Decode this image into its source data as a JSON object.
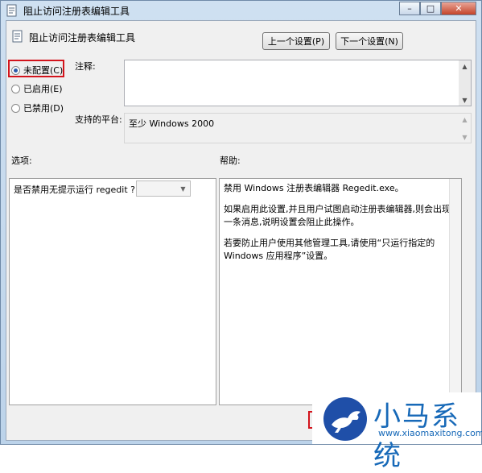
{
  "window": {
    "title": "阻止访问注册表编辑工具",
    "controls": {
      "minimize": "–",
      "maximize": "□",
      "close": "✕"
    }
  },
  "header": {
    "policy_name": "阻止访问注册表编辑工具",
    "prev_button": "上一个设置(P)",
    "next_button": "下一个设置(N)"
  },
  "state": {
    "options": [
      {
        "label": "未配置(C)",
        "selected": true
      },
      {
        "label": "已启用(E)",
        "selected": false
      },
      {
        "label": "已禁用(D)",
        "selected": false
      }
    ]
  },
  "comment": {
    "label": "注释:",
    "value": ""
  },
  "platform": {
    "label": "支持的平台:",
    "value": "至少 Windows 2000"
  },
  "options_section": {
    "label": "选项:",
    "question": "是否禁用无提示运行 regedit ?",
    "select_value": ""
  },
  "help_section": {
    "label": "帮助:",
    "paragraphs": [
      "禁用 Windows 注册表编辑器 Regedit.exe。",
      "如果启用此设置,并且用户试图启动注册表编辑器,则会出现一条消息,说明设置会阻止此操作。",
      "若要防止用户使用其他管理工具,请使用“只运行指定的 Windows 应用程序”设置。"
    ]
  },
  "watermark": {
    "brand": "小马系统",
    "url": "www.xiaomaxitong.com"
  },
  "colors": {
    "highlight": "#d3141c",
    "brand_blue": "#1769b8"
  }
}
